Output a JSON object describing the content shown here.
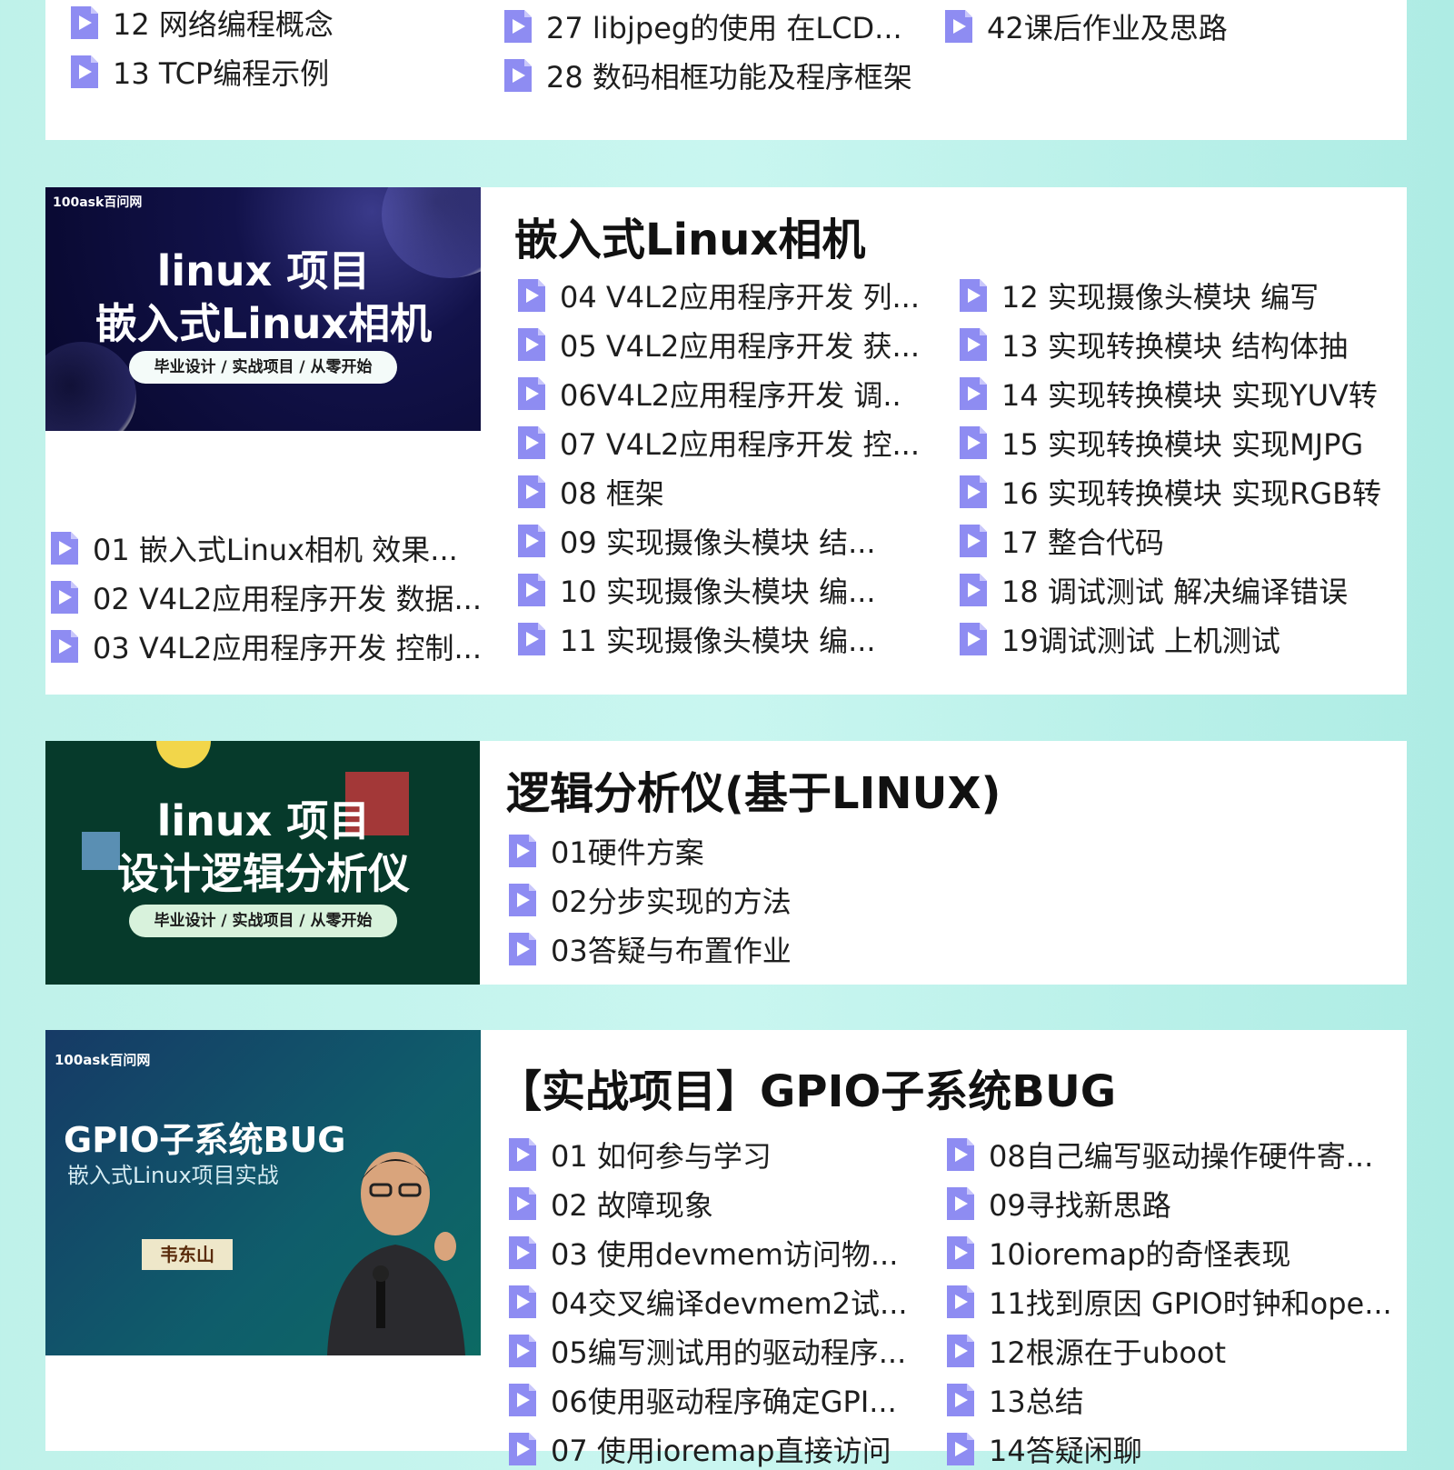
{
  "top_card": {
    "lessons": [
      "12 网络编程概念",
      "13 TCP编程示例",
      "27 libjpeg的使用 在LCD...",
      "28 数码相框功能及程序框架",
      "42课后作业及思路"
    ]
  },
  "camera_course": {
    "title": "嵌入式Linux相机",
    "banner": {
      "brand": "100ask百问网",
      "line1": "linux 项目",
      "line2": "嵌入式Linux相机",
      "tagline": "毕业设计 / 实战项目 / 从零开始"
    },
    "lessons": [
      "01  嵌入式Linux相机 效果...",
      "02 V4L2应用程序开发 数据...",
      "03 V4L2应用程序开发 控制...",
      "04 V4L2应用程序开发 列...",
      "05 V4L2应用程序开发 获...",
      "06V4L2应用程序开发 调..",
      "07 V4L2应用程序开发 控...",
      "08 框架",
      "09 实现摄像头模块 结...",
      "10 实现摄像头模块 编...",
      "11 实现摄像头模块 编...",
      "12 实现摄像头模块 编写",
      "13 实现转换模块 结构体抽",
      "14 实现转换模块 实现YUV转",
      "15 实现转换模块 实现MJPG",
      "16 实现转换模块 实现RGB转",
      "17 整合代码",
      "18 调试测试 解决编译错误",
      "19调试测试 上机测试"
    ]
  },
  "logic_course": {
    "title": "逻辑分析仪(基于LINUX)",
    "banner": {
      "line1": "linux 项目",
      "line2": "设计逻辑分析仪",
      "tagline": "毕业设计 / 实战项目 / 从零开始"
    },
    "lessons": [
      "01硬件方案",
      "02分步实现的方法",
      "03答疑与布置作业"
    ]
  },
  "gpio_course": {
    "title": "【实战项目】GPIO子系统BUG",
    "banner": {
      "brand": "100ask百问网",
      "line1": "GPIO子系统BUG",
      "line2": "嵌入式Linux项目实战",
      "name_tag": "韦东山"
    },
    "lessons": [
      "01 如何参与学习",
      "02 故障现象",
      "03 使用devmem访问物...",
      "04交叉编译devmem2试...",
      "05编写测试用的驱动程序...",
      "06使用驱动程序确定GPI...",
      "07 使用ioremap直接访问",
      "08自己编写驱动操作硬件寄...",
      "09寻找新思路",
      "10ioremap的奇怪表现",
      "11找到原因 GPIO时钟和ope...",
      "12根源在于uboot",
      "13总结",
      "14答疑闲聊"
    ]
  },
  "colors": {
    "background": "#bff2ea",
    "play_icon": "#8e8cf2",
    "camera_banner": "#0b0b3a",
    "logic_banner": "#063a2b",
    "gpio_banner": "#0e4f63"
  }
}
